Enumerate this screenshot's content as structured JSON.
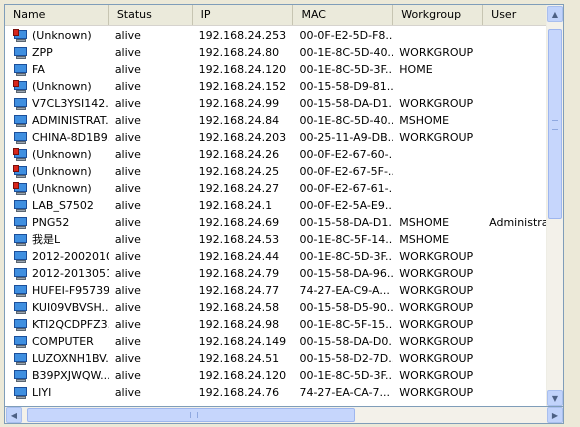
{
  "columns": [
    "Name",
    "Status",
    "IP",
    "MAC",
    "Workgroup",
    "User"
  ],
  "rows": [
    {
      "icon": "computer-warning-icon",
      "name": "(Unknown)",
      "status": "alive",
      "ip": "192.168.24.253",
      "mac": "00-0F-E2-5D-F8...",
      "workgroup": "",
      "user": ""
    },
    {
      "icon": "computer-icon",
      "name": "ZPP",
      "status": "alive",
      "ip": "192.168.24.80",
      "mac": "00-1E-8C-5D-40...",
      "workgroup": "WORKGROUP",
      "user": ""
    },
    {
      "icon": "computer-icon",
      "name": "FA",
      "status": "alive",
      "ip": "192.168.24.120",
      "mac": "00-1E-8C-5D-3F...",
      "workgroup": "HOME",
      "user": ""
    },
    {
      "icon": "computer-warning-icon",
      "name": "(Unknown)",
      "status": "alive",
      "ip": "192.168.24.152",
      "mac": "00-15-58-D9-81...",
      "workgroup": "",
      "user": ""
    },
    {
      "icon": "computer-icon",
      "name": "V7CL3YSI142...",
      "status": "alive",
      "ip": "192.168.24.99",
      "mac": "00-15-58-DA-D1...",
      "workgroup": "WORKGROUP",
      "user": ""
    },
    {
      "icon": "computer-icon",
      "name": "ADMINISTRAT...",
      "status": "alive",
      "ip": "192.168.24.84",
      "mac": "00-1E-8C-5D-40...",
      "workgroup": "MSHOME",
      "user": ""
    },
    {
      "icon": "computer-icon",
      "name": "CHINA-8D1B9...",
      "status": "alive",
      "ip": "192.168.24.203",
      "mac": "00-25-11-A9-DB...",
      "workgroup": "WORKGROUP",
      "user": ""
    },
    {
      "icon": "computer-warning-icon",
      "name": "(Unknown)",
      "status": "alive",
      "ip": "192.168.24.26",
      "mac": "00-0F-E2-67-60-...",
      "workgroup": "",
      "user": ""
    },
    {
      "icon": "computer-warning-icon",
      "name": "(Unknown)",
      "status": "alive",
      "ip": "192.168.24.25",
      "mac": "00-0F-E2-67-5F-...",
      "workgroup": "",
      "user": ""
    },
    {
      "icon": "computer-warning-icon",
      "name": "(Unknown)",
      "status": "alive",
      "ip": "192.168.24.27",
      "mac": "00-0F-E2-67-61-...",
      "workgroup": "",
      "user": ""
    },
    {
      "icon": "computer-icon",
      "name": "LAB_S7502",
      "status": "alive",
      "ip": "192.168.24.1",
      "mac": "00-0F-E2-5A-E9...",
      "workgroup": "",
      "user": ""
    },
    {
      "icon": "computer-icon",
      "name": "PNG52",
      "status": "alive",
      "ip": "192.168.24.69",
      "mac": "00-15-58-DA-D1...",
      "workgroup": "MSHOME",
      "user": "Administrator"
    },
    {
      "icon": "computer-icon",
      "name": "我是L",
      "status": "alive",
      "ip": "192.168.24.53",
      "mac": "00-1E-8C-5F-14...",
      "workgroup": "MSHOME",
      "user": ""
    },
    {
      "icon": "computer-icon",
      "name": "2012-2002010...",
      "status": "alive",
      "ip": "192.168.24.44",
      "mac": "00-1E-8C-5D-3F...",
      "workgroup": "WORKGROUP",
      "user": ""
    },
    {
      "icon": "computer-icon",
      "name": "2012-2013051...",
      "status": "alive",
      "ip": "192.168.24.79",
      "mac": "00-15-58-DA-96...",
      "workgroup": "WORKGROUP",
      "user": ""
    },
    {
      "icon": "computer-icon",
      "name": "HUFEI-F95739...",
      "status": "alive",
      "ip": "192.168.24.77",
      "mac": "74-27-EA-C9-A...",
      "workgroup": "WORKGROUP",
      "user": ""
    },
    {
      "icon": "computer-icon",
      "name": "KUI09VBVSH...",
      "status": "alive",
      "ip": "192.168.24.58",
      "mac": "00-15-58-D5-90...",
      "workgroup": "WORKGROUP",
      "user": ""
    },
    {
      "icon": "computer-icon",
      "name": "KTI2QCDPFZ3...",
      "status": "alive",
      "ip": "192.168.24.98",
      "mac": "00-1E-8C-5F-15...",
      "workgroup": "WORKGROUP",
      "user": ""
    },
    {
      "icon": "computer-icon",
      "name": "COMPUTER",
      "status": "alive",
      "ip": "192.168.24.149",
      "mac": "00-15-58-DA-D0...",
      "workgroup": "WORKGROUP",
      "user": ""
    },
    {
      "icon": "computer-icon",
      "name": "LUZOXNH1BV...",
      "status": "alive",
      "ip": "192.168.24.51",
      "mac": "00-15-58-D2-7D...",
      "workgroup": "WORKGROUP",
      "user": ""
    },
    {
      "icon": "computer-icon",
      "name": "B39PXJWQW...",
      "status": "alive",
      "ip": "192.168.24.120",
      "mac": "00-1E-8C-5D-3F...",
      "workgroup": "WORKGROUP",
      "user": ""
    },
    {
      "icon": "computer-icon",
      "name": "LIYI",
      "status": "alive",
      "ip": "192.168.24.76",
      "mac": "74-27-EA-CA-7...",
      "workgroup": "WORKGROUP",
      "user": ""
    }
  ],
  "colors": {
    "scrollbar": "#c1d3fb",
    "header": "#ebeadb",
    "icon_screen": "#3f8fe0",
    "warning": "#d8261c"
  }
}
